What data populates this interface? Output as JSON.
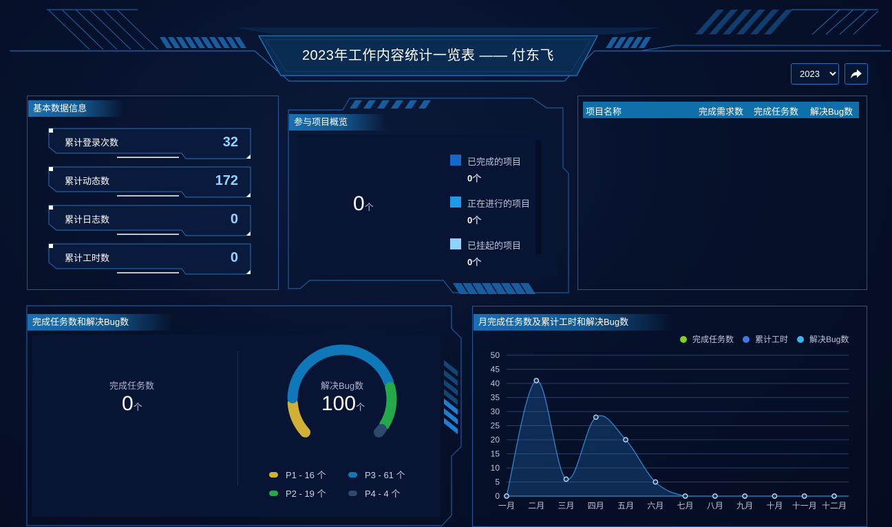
{
  "header": {
    "title": "2023年工作内容统计一览表 —— 付东飞",
    "year_selected": "2023",
    "share_icon": "share-icon"
  },
  "basic_info": {
    "title": "基本数据信息",
    "stats": [
      {
        "label": "累计登录次数",
        "value": "32"
      },
      {
        "label": "累计动态数",
        "value": "172"
      },
      {
        "label": "累计日志数",
        "value": "0"
      },
      {
        "label": "累计工时数",
        "value": "0"
      }
    ]
  },
  "projects_overview": {
    "title": "参与项目概览",
    "total": "0",
    "unit": "个",
    "legend": [
      {
        "label": "已完成的项目",
        "count": "0",
        "color": "#1568c7"
      },
      {
        "label": "正在进行的项目",
        "count": "0",
        "color": "#1f9ae8"
      },
      {
        "label": "已挂起的项目",
        "count": "0",
        "color": "#8fd3ff"
      }
    ]
  },
  "project_table": {
    "columns": [
      "项目名称",
      "完成需求数",
      "完成任务数",
      "解决Bug数"
    ],
    "rows": []
  },
  "tasks_bugs": {
    "title": "完成任务数和解决Bug数",
    "tasks_label": "完成任务数",
    "tasks_value": "0",
    "bugs_label": "解决Bug数",
    "bugs_value": "100",
    "unit": "个",
    "priorities": [
      {
        "label": "P1 - 16 个",
        "value": 16,
        "color": "#d2b035"
      },
      {
        "label": "P2 - 19 个",
        "value": 19,
        "color": "#23a84a"
      },
      {
        "label": "P3 - 61 个",
        "value": 61,
        "color": "#0f78b8"
      },
      {
        "label": "P4 - 4 个",
        "value": 4,
        "color": "#2c4a6e"
      }
    ]
  },
  "monthly_chart": {
    "title": "月完成任务数及累计工时和解决Bug数",
    "legend": [
      {
        "label": "完成任务数",
        "color": "#7ed321"
      },
      {
        "label": "累计工时",
        "color": "#3d7be6"
      },
      {
        "label": "解决Bug数",
        "color": "#3ab3f0"
      }
    ]
  },
  "chart_data": {
    "type": "area",
    "categories": [
      "一月",
      "二月",
      "三月",
      "四月",
      "五月",
      "六月",
      "七月",
      "八月",
      "九月",
      "十月",
      "十一月",
      "十二月"
    ],
    "series": [
      {
        "name": "完成任务数",
        "values": [
          0,
          0,
          0,
          0,
          0,
          0,
          0,
          0,
          0,
          0,
          0,
          0
        ]
      },
      {
        "name": "累计工时",
        "values": [
          0,
          0,
          0,
          0,
          0,
          0,
          0,
          0,
          0,
          0,
          0,
          0
        ]
      },
      {
        "name": "解决Bug数",
        "values": [
          0,
          41,
          6,
          28,
          20,
          5,
          0,
          0,
          0,
          0,
          0,
          0
        ]
      }
    ],
    "yticks": [
      0,
      5,
      10,
      15,
      20,
      25,
      30,
      35,
      40,
      45,
      50
    ],
    "ylim": [
      0,
      50
    ],
    "grid": true,
    "legend_position": "top-right"
  }
}
